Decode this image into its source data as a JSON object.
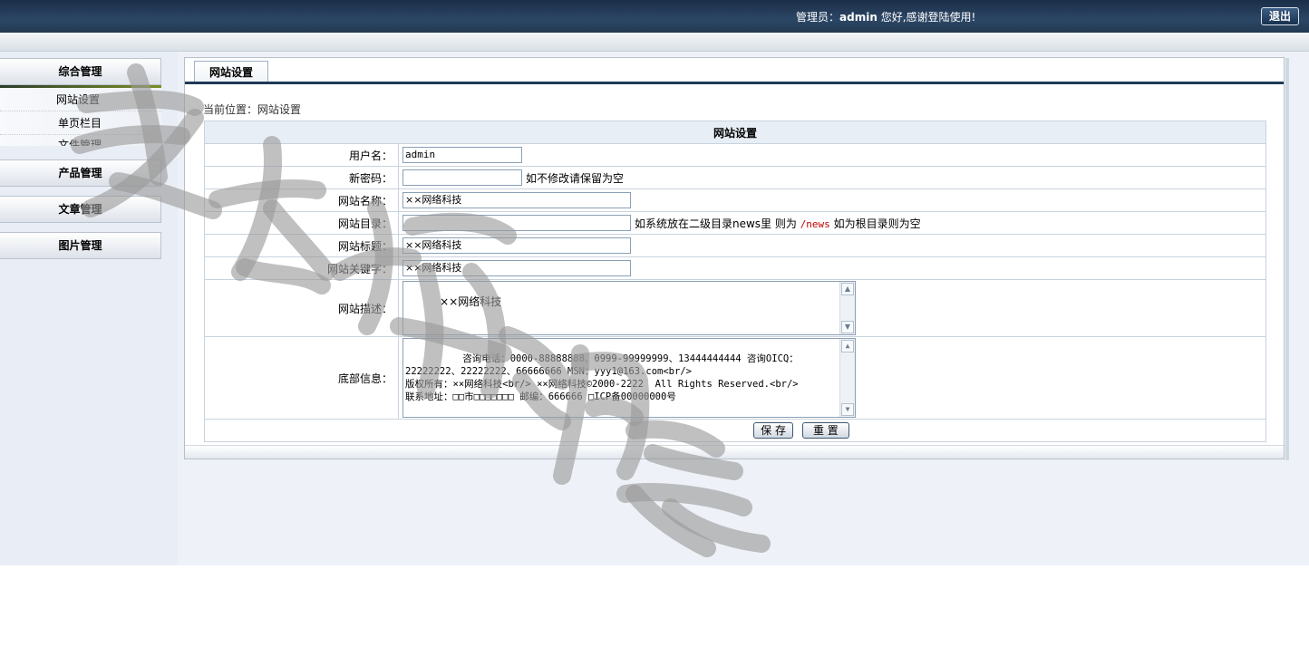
{
  "header": {
    "greeting_prefix": "管理员：",
    "username": "admin",
    "greeting_suffix": " 您好,感谢登陆使用!",
    "logout_label": "退出"
  },
  "sidebar": {
    "groups": [
      {
        "label": "综合管理",
        "items": [
          "网站设置",
          "单页栏目",
          "文件管理"
        ]
      },
      {
        "label": "产品管理"
      },
      {
        "label": "文章管理"
      },
      {
        "label": "图片管理"
      }
    ]
  },
  "panel": {
    "tab_label": "网站设置",
    "breadcrumb": "当前位置：网站设置",
    "table_title": "网站设置"
  },
  "form": {
    "username": {
      "label": "用户名：",
      "value": "admin"
    },
    "password": {
      "label": "新密码：",
      "value": "",
      "hint": "如不修改请保留为空"
    },
    "site_name": {
      "label": "网站名称：",
      "value": "××网络科技"
    },
    "site_dir": {
      "label": "网站目录：",
      "value": "",
      "hint_prefix": "如系统放在二级目录news里 则为 ",
      "hint_code": "/news",
      "hint_suffix": "  如为根目录则为空"
    },
    "site_title": {
      "label": "网站标题：",
      "value": "××网络科技"
    },
    "site_keywords": {
      "label": "网站关键字：",
      "value": "××网络科技"
    },
    "site_desc": {
      "label": "网站描述：",
      "value": "××网络科技"
    },
    "footer_info": {
      "label": "底部信息：",
      "value": "咨询电话：0000-88888888、0999-99999999、13444444444 咨询OICQ：22222222、22222222、66666666 MSN：yyy1@163.com<br/>\n版权所有：××网络科技<br/> ××网络科技©2000-2222  All Rights Reserved.<br/>\n联系地址：□□市□□□□□□□ 邮编：666666 □ICP备00000000号"
    },
    "save_label": "保 存",
    "reset_label": "重 置"
  },
  "watermark": {
    "text": "老杨源码"
  }
}
